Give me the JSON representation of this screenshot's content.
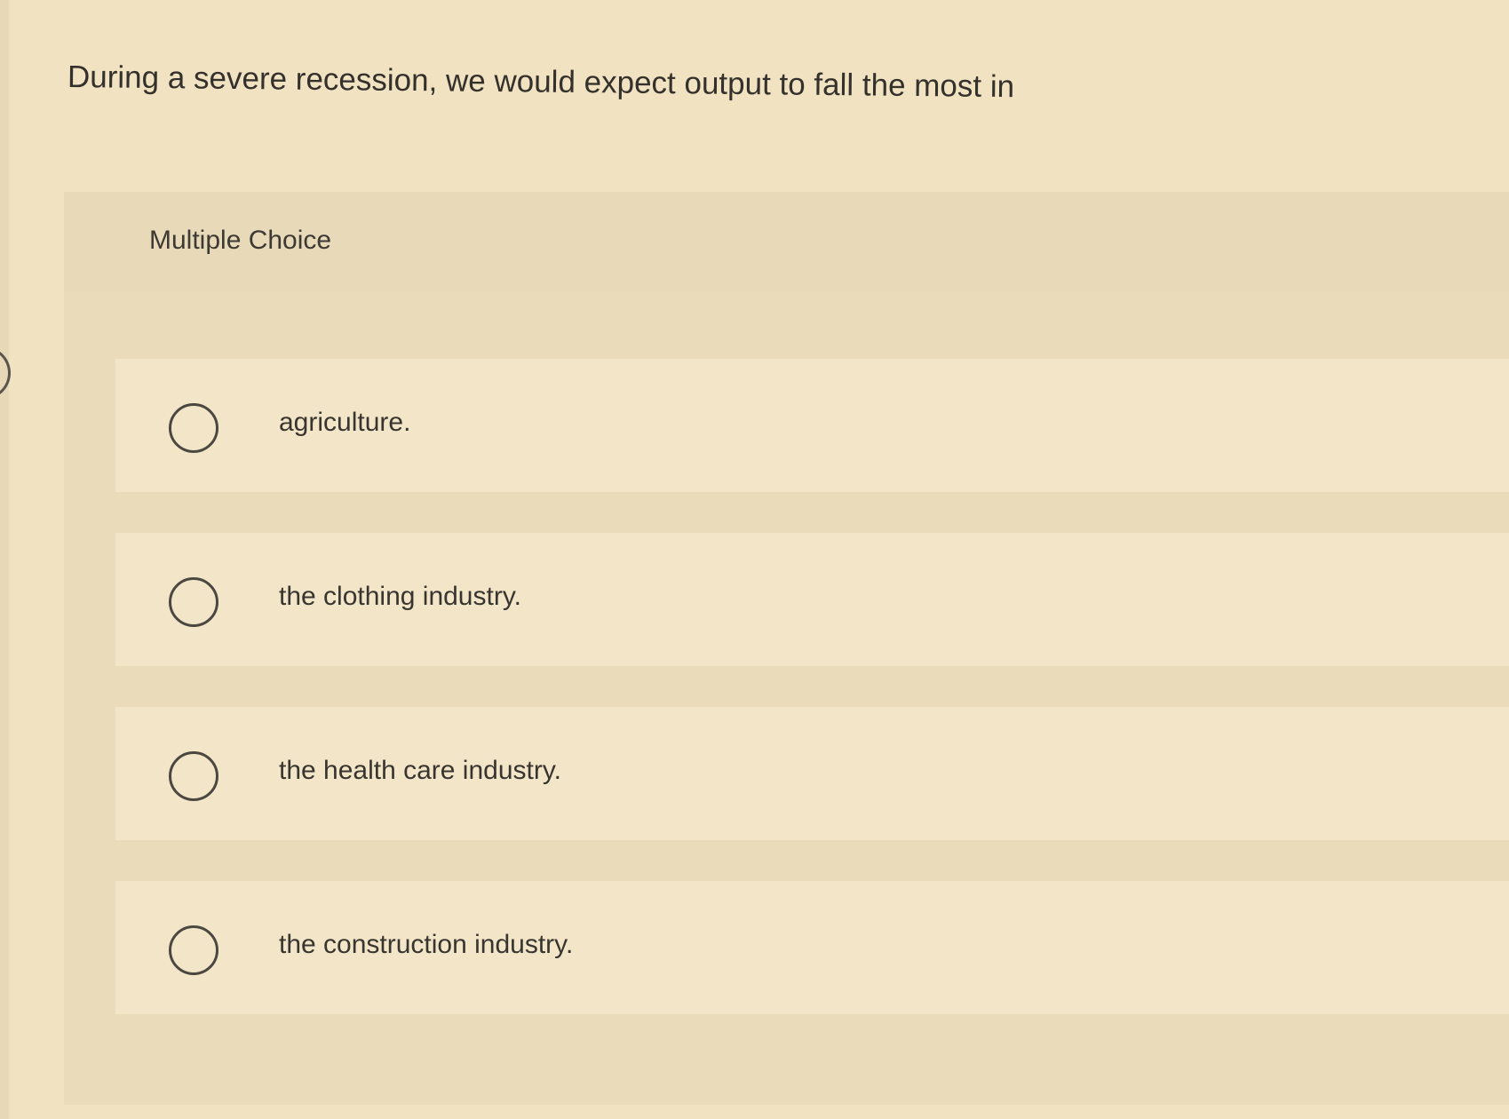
{
  "question": {
    "text": "During a severe recession, we would expect output to fall the most in"
  },
  "panel": {
    "label": "Multiple Choice"
  },
  "options": [
    {
      "label": "agriculture.",
      "selected": false
    },
    {
      "label": "the clothing industry.",
      "selected": false
    },
    {
      "label": "the health care industry.",
      "selected": false
    },
    {
      "label": "the construction industry.",
      "selected": false
    }
  ]
}
